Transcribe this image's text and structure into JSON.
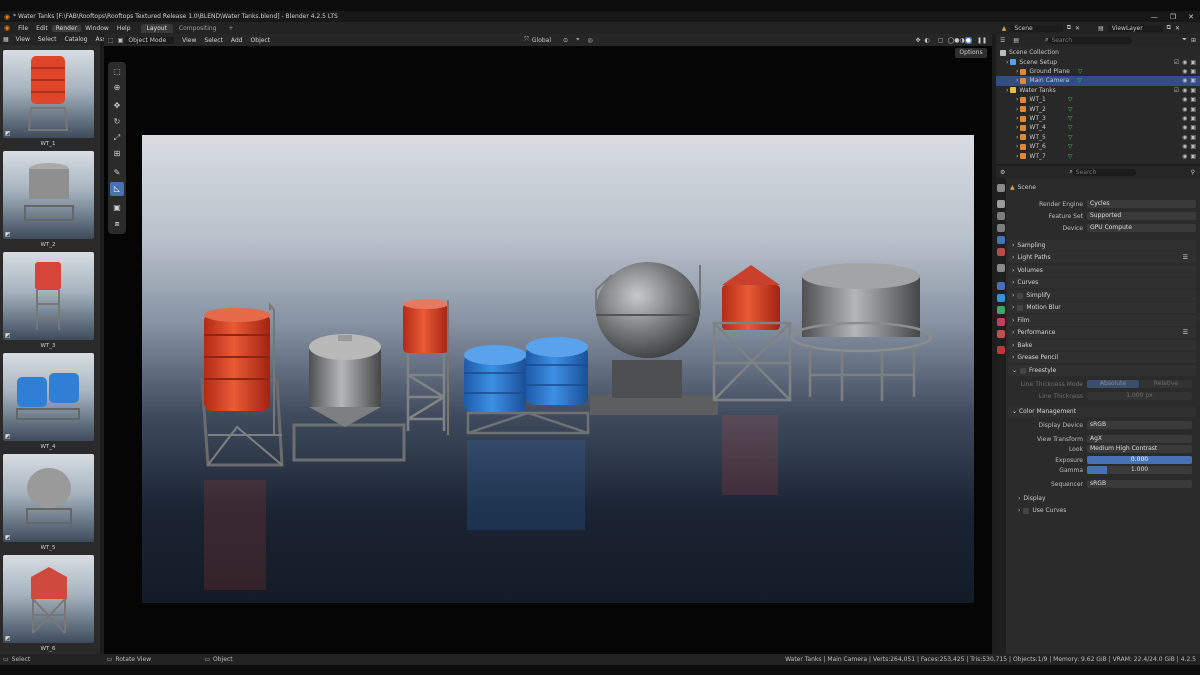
{
  "window": {
    "title": "* Water Tanks [F:\\FAB\\Rooftops\\Rooftops Textured Release 1.0\\BLEND\\Water Tanks.blend] - Blender 4.2.5 LTS",
    "controls": [
      "—",
      "❐",
      "✕"
    ]
  },
  "menu": {
    "items": [
      "File",
      "Edit",
      "Render",
      "Window",
      "Help"
    ],
    "workspaces": [
      "Layout",
      "Compositing",
      "+"
    ],
    "scene_label": "Scene",
    "viewlayer_label": "ViewLayer"
  },
  "asset_browser": {
    "header": [
      "View",
      "Select",
      "Catalog",
      "Asse"
    ],
    "assets": [
      {
        "label": "WT_1",
        "color": "#e0452a",
        "style": "stack"
      },
      {
        "label": "WT_2",
        "color": "#8f8f8f",
        "style": "silo"
      },
      {
        "label": "WT_3",
        "color": "#d7453a",
        "style": "tower"
      },
      {
        "label": "WT_4",
        "color": "#2f7fd6",
        "style": "pair"
      },
      {
        "label": "WT_5",
        "color": "#9a9a9a",
        "style": "sphere"
      },
      {
        "label": "WT_6",
        "color": "#cf4a3e",
        "style": "cone"
      }
    ]
  },
  "viewport": {
    "mode": "Object Mode",
    "menus": [
      "View",
      "Select",
      "Add",
      "Object"
    ],
    "orientation": "Global",
    "options_label": "Options"
  },
  "outliner": {
    "search_placeholder": "Search",
    "items": [
      {
        "label": "Scene Collection",
        "kind": "root",
        "color": "#bdbdbd"
      },
      {
        "label": "Scene Setup",
        "kind": "collection",
        "color": "#5aa0e6"
      },
      {
        "label": "Ground Plane",
        "kind": "object",
        "color": "#e0883a"
      },
      {
        "label": "Main Camera",
        "kind": "object",
        "color": "#e0883a"
      },
      {
        "label": "Water Tanks",
        "kind": "collection",
        "color": "#e6c23a"
      },
      {
        "label": "WT_1",
        "kind": "object",
        "color": "#e0883a"
      },
      {
        "label": "WT_2",
        "kind": "object",
        "color": "#e0883a"
      },
      {
        "label": "WT_3",
        "kind": "object",
        "color": "#e0883a"
      },
      {
        "label": "WT_4",
        "kind": "object",
        "color": "#e0883a"
      },
      {
        "label": "WT_5",
        "kind": "object",
        "color": "#e0883a"
      },
      {
        "label": "WT_6",
        "kind": "object",
        "color": "#e0883a"
      },
      {
        "label": "WT_7",
        "kind": "object",
        "color": "#e0883a"
      }
    ]
  },
  "properties": {
    "search_placeholder": "Search",
    "context": "Scene",
    "render_engine_label": "Render Engine",
    "render_engine": "Cycles",
    "feature_set_label": "Feature Set",
    "feature_set": "Supported",
    "device_label": "Device",
    "device": "GPU Compute",
    "panels": [
      "Sampling",
      "Light Paths",
      "Volumes",
      "Curves",
      "Simplify",
      "Motion Blur",
      "Film",
      "Performance",
      "Bake",
      "Grease Pencil",
      "Freestyle"
    ],
    "freestyle": {
      "line_mode_label": "Line Thickness Mode",
      "absolute": "Absolute",
      "relative": "Relative",
      "thickness_label": "Line Thickness",
      "thickness": "1.000 px"
    },
    "color_management": {
      "title": "Color Management",
      "display_device_label": "Display Device",
      "display_device": "sRGB",
      "view_transform_label": "View Transform",
      "view_transform": "AgX",
      "look_label": "Look",
      "look": "Medium High Contrast",
      "exposure_label": "Exposure",
      "exposure": "0.000",
      "gamma_label": "Gamma",
      "gamma": "1.000",
      "sequencer_label": "Sequencer",
      "sequencer": "sRGB",
      "display_sub": "Display",
      "use_curves": "Use Curves"
    }
  },
  "status": {
    "left": [
      "Select",
      "Rotate View",
      "Object"
    ],
    "right": "Water Tanks | Main Camera | Verts:264,051 | Faces:253,425 | Tris:530,715 | Objects:1/9 | Memory: 9.62 GiB | VRAM: 22.4/24.0 GiB | 4.2.5"
  },
  "colors": {
    "accent": "#4772b3",
    "selection": "#334d80",
    "red_tank": "#d9472d",
    "blue_tank": "#2f7fd6",
    "metal": "#8e9092"
  }
}
